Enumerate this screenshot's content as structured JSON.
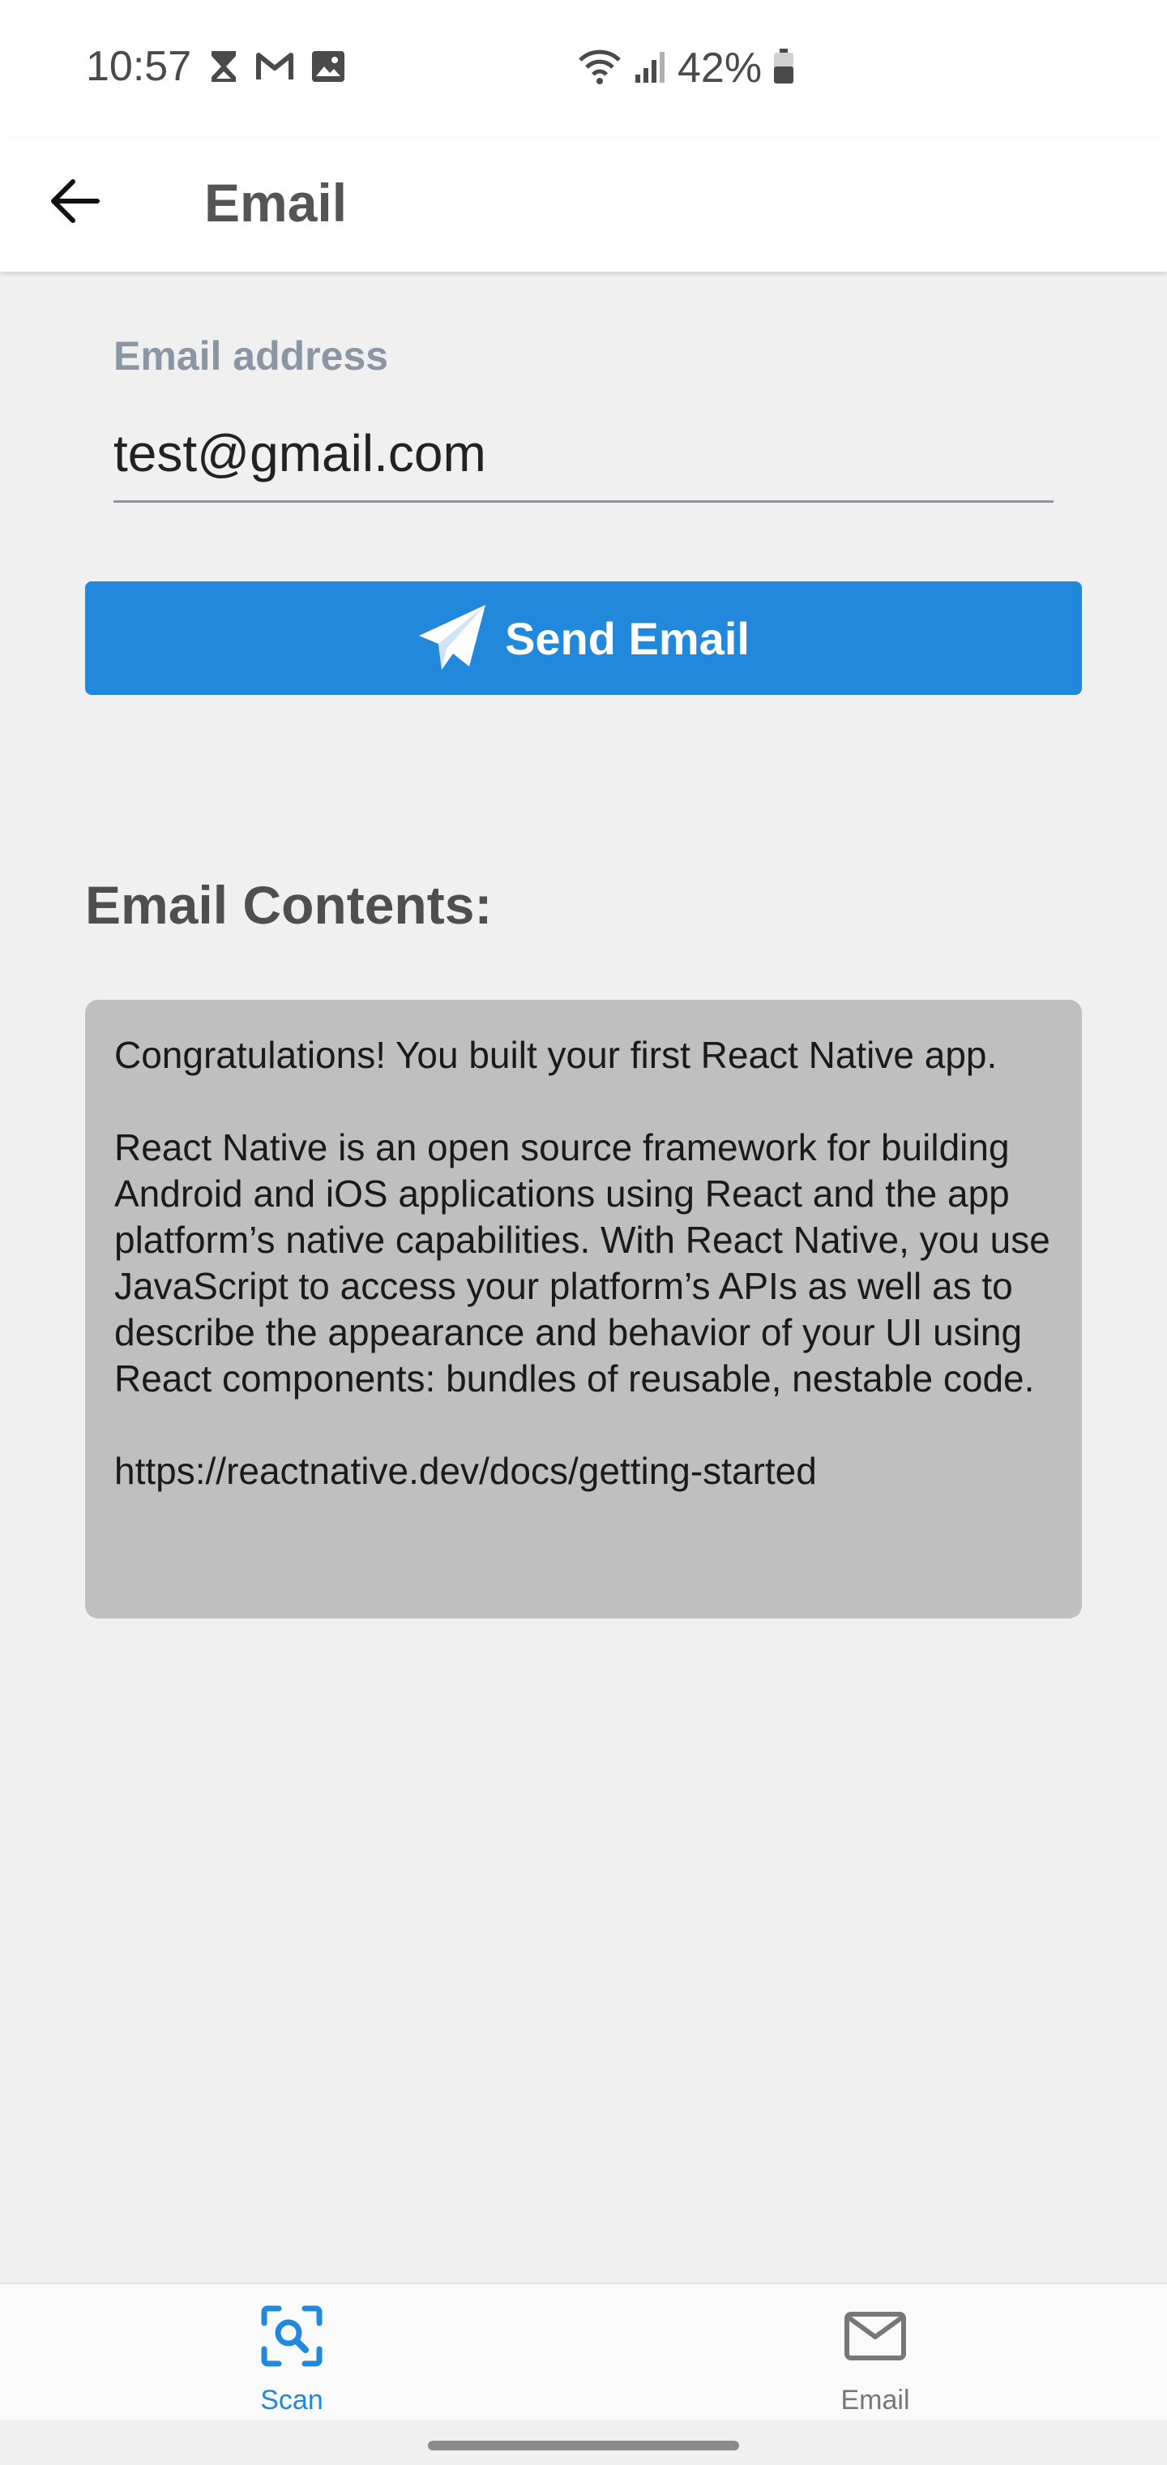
{
  "status_bar": {
    "time": "10:57",
    "battery": "42%",
    "left_icons": [
      "hourglass-icon",
      "gmail-icon",
      "image-icon"
    ],
    "right_icons": [
      "wifi-icon",
      "signal-icon",
      "battery-icon"
    ]
  },
  "app_bar": {
    "title": "Email",
    "back_icon": "arrow-left-icon"
  },
  "form": {
    "email_label": "Email address",
    "email_value": "test@gmail.com"
  },
  "send_button": {
    "label": "Send Email",
    "icon": "paper-plane-icon"
  },
  "contents": {
    "heading": "Email Contents:",
    "paragraph1": "Congratulations! You built your first React Native app.",
    "paragraph2": "React Native is an open source framework for building Android and iOS applications using React and the app platform’s native capabilities. With React Native, you use JavaScript to access your platform’s APIs as well as to describe the appearance and behavior of your UI using React components: bundles of reusable, nestable code.",
    "link": "https://reactnative.dev/docs/getting-started"
  },
  "bottom_nav": {
    "items": [
      {
        "label": "Scan",
        "icon": "scan-search-icon",
        "active": true
      },
      {
        "label": "Email",
        "icon": "mail-icon",
        "active": false
      }
    ]
  },
  "colors": {
    "accent": "#2188dc",
    "label": "#8a96a3",
    "box_bg": "#bfbfbf",
    "page_bg": "#f0f0f0"
  }
}
